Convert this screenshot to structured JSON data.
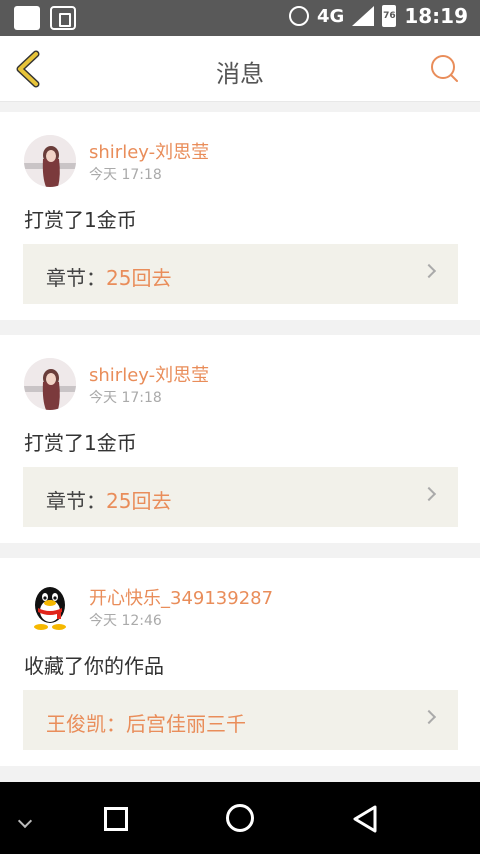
{
  "status_bar": {
    "network": "4G",
    "battery": "76",
    "time": "18:19"
  },
  "header": {
    "title": "消息"
  },
  "messages": [
    {
      "username": "shirley-刘思莹",
      "timestamp": "今天 17:18",
      "action": "打赏了1金币",
      "chapter_label": "章节：",
      "chapter_value": "25回去"
    },
    {
      "username": "shirley-刘思莹",
      "timestamp": "今天 17:18",
      "action": "打赏了1金币",
      "chapter_label": "章节：",
      "chapter_value": "25回去"
    },
    {
      "username": "开心快乐_349139287",
      "timestamp": "今天 12:46",
      "action": "收藏了你的作品",
      "chapter_label": "",
      "chapter_value": "王俊凯：后宫佳丽三千"
    }
  ],
  "colors": {
    "accent": "#e98d5a",
    "back_icon": "#e7c43a",
    "status_bar_bg": "#595959",
    "chapter_bg": "#f2f1ea"
  },
  "icons": {
    "back": "chevron-left-icon",
    "search": "search-icon"
  }
}
